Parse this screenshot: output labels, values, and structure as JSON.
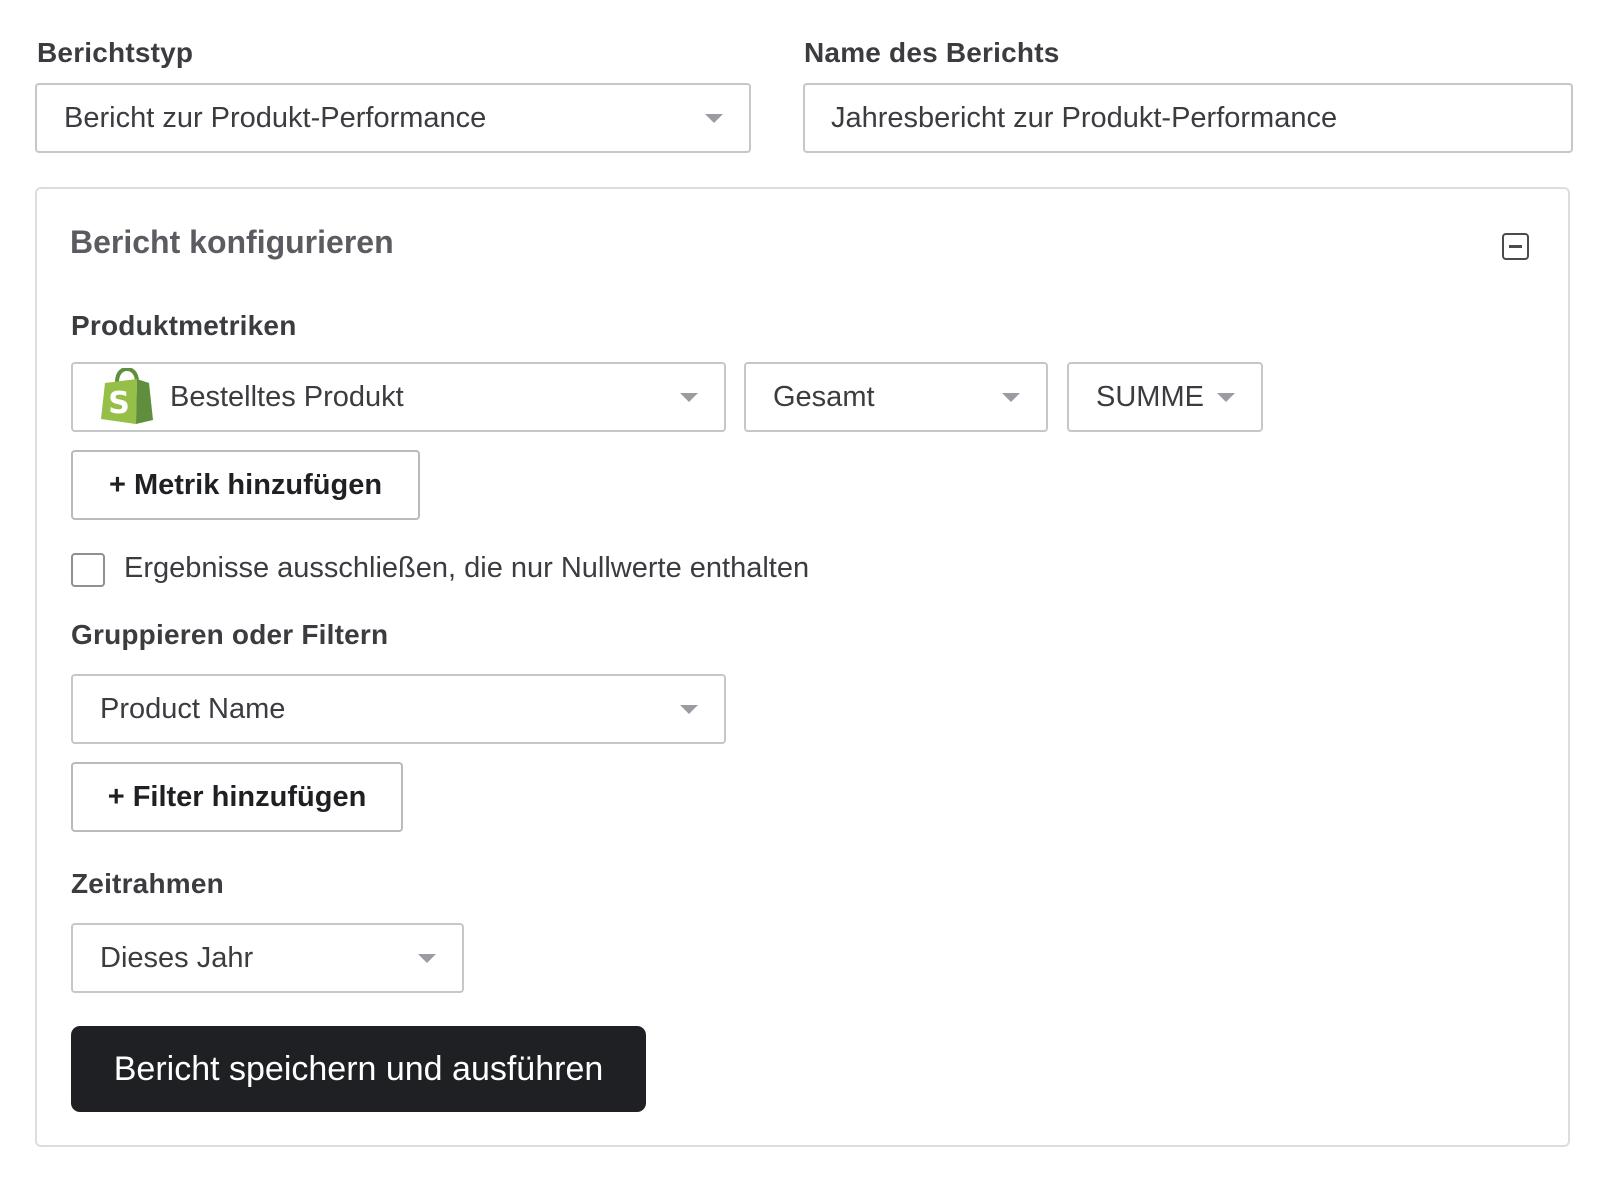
{
  "report_type": {
    "label": "Berichtstyp",
    "value": "Bericht zur Produkt-Performance"
  },
  "report_name": {
    "label": "Name des Berichts",
    "value": "Jahresbericht zur Produkt-Performance"
  },
  "configure": {
    "title": "Bericht konfigurieren",
    "metrics": {
      "label": "Produktmetriken",
      "metric_select": "Bestelltes Produkt",
      "aggregate_select": "Gesamt",
      "function_select": "SUMME",
      "add_metric_label": "+ Metrik hinzufügen"
    },
    "exclude_zero": {
      "label": "Ergebnisse ausschließen, die nur Nullwerte enthalten",
      "checked": false
    },
    "group_filter": {
      "label": "Gruppieren oder Filtern",
      "group_select": "Product Name",
      "add_filter_label": "+ Filter hinzufügen"
    },
    "timeframe": {
      "label": "Zeitrahmen",
      "value": "Dieses Jahr"
    },
    "save_run_label": "Bericht speichern und ausführen"
  },
  "colors": {
    "primary_button": "#1f2023",
    "shopify_green": "#95bf47",
    "shopify_dark_green": "#5e8e3e"
  },
  "icons": {
    "metric_source": "shopify-bag-icon",
    "collapse": "collapse-minus-icon",
    "dropdown": "chevron-down-icon"
  }
}
